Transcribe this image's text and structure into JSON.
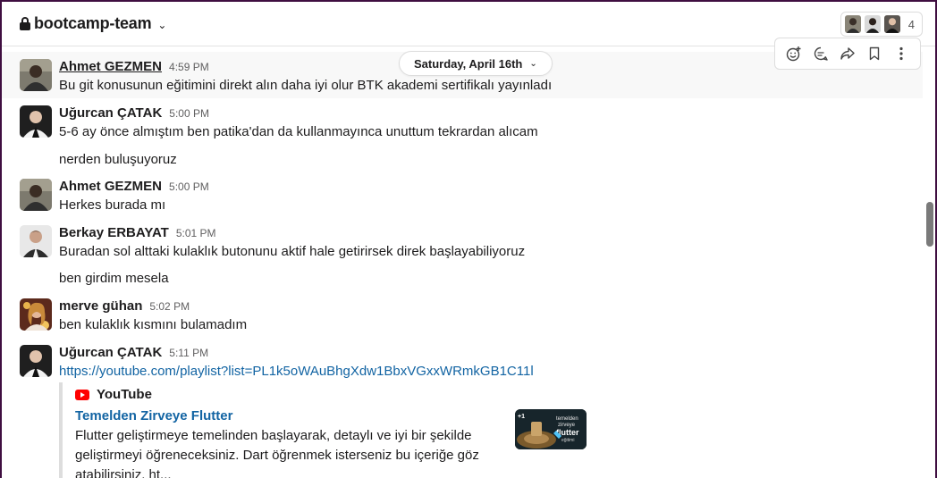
{
  "header": {
    "channel_name": "bootcamp-team",
    "member_count": "4"
  },
  "date_divider": {
    "label": "Saturday, April 16th"
  },
  "message_actions": [
    "add-reaction",
    "reply-in-thread",
    "share-message",
    "save-message",
    "more-actions"
  ],
  "messages": [
    {
      "author": "Ahmet GEZMEN",
      "time": "4:59 PM",
      "lines": [
        "Bu git konusunun eğitimini direkt alın daha iyi olur BTK akademi sertifikalı yayınladı"
      ]
    },
    {
      "author": "Uğurcan ÇATAK",
      "time": "5:00 PM",
      "lines": [
        "5-6 ay önce almıştım ben patika'dan da kullanmayınca unuttum tekrardan alıcam",
        "nerden buluşuyoruz"
      ]
    },
    {
      "author": "Ahmet GEZMEN",
      "time": "5:00 PM",
      "lines": [
        "Herkes burada mı"
      ]
    },
    {
      "author": "Berkay ERBAYAT",
      "time": "5:01 PM",
      "lines": [
        "Buradan sol alttaki kulaklık butonunu aktif hale getirirsek direk başlayabiliyoruz",
        "ben girdim mesela"
      ]
    },
    {
      "author": "merve gühan",
      "time": "5:02 PM",
      "lines": [
        "ben kulaklık kısmını bulamadım"
      ]
    },
    {
      "author": "Uğurcan ÇATAK",
      "time": "5:11 PM",
      "lines": [
        "https://youtube.com/playlist?list=PL1k5oWAuBhgXdw1BbxVGxxWRmkGB1C11l"
      ]
    }
  ],
  "unfurl": {
    "service": "YouTube",
    "title": "Temelden Zirveye Flutter",
    "description": "Flutter geliştirmeye temelinden başlayarak, detaylı ve iyi bir şekilde geliştirmeyi öğreneceksiniz. Dart öğrenmek isterseniz bu içeriğe göz atabilirsiniz. ht...",
    "thumbnail": {
      "badge": "+1",
      "line1": "temelden",
      "line2": "zirveye",
      "line3": "flutter",
      "line4": "eğitimi"
    }
  },
  "colors": {
    "frame": "#3f0e40",
    "link": "#1264a3",
    "youtube": "#ff0000"
  }
}
